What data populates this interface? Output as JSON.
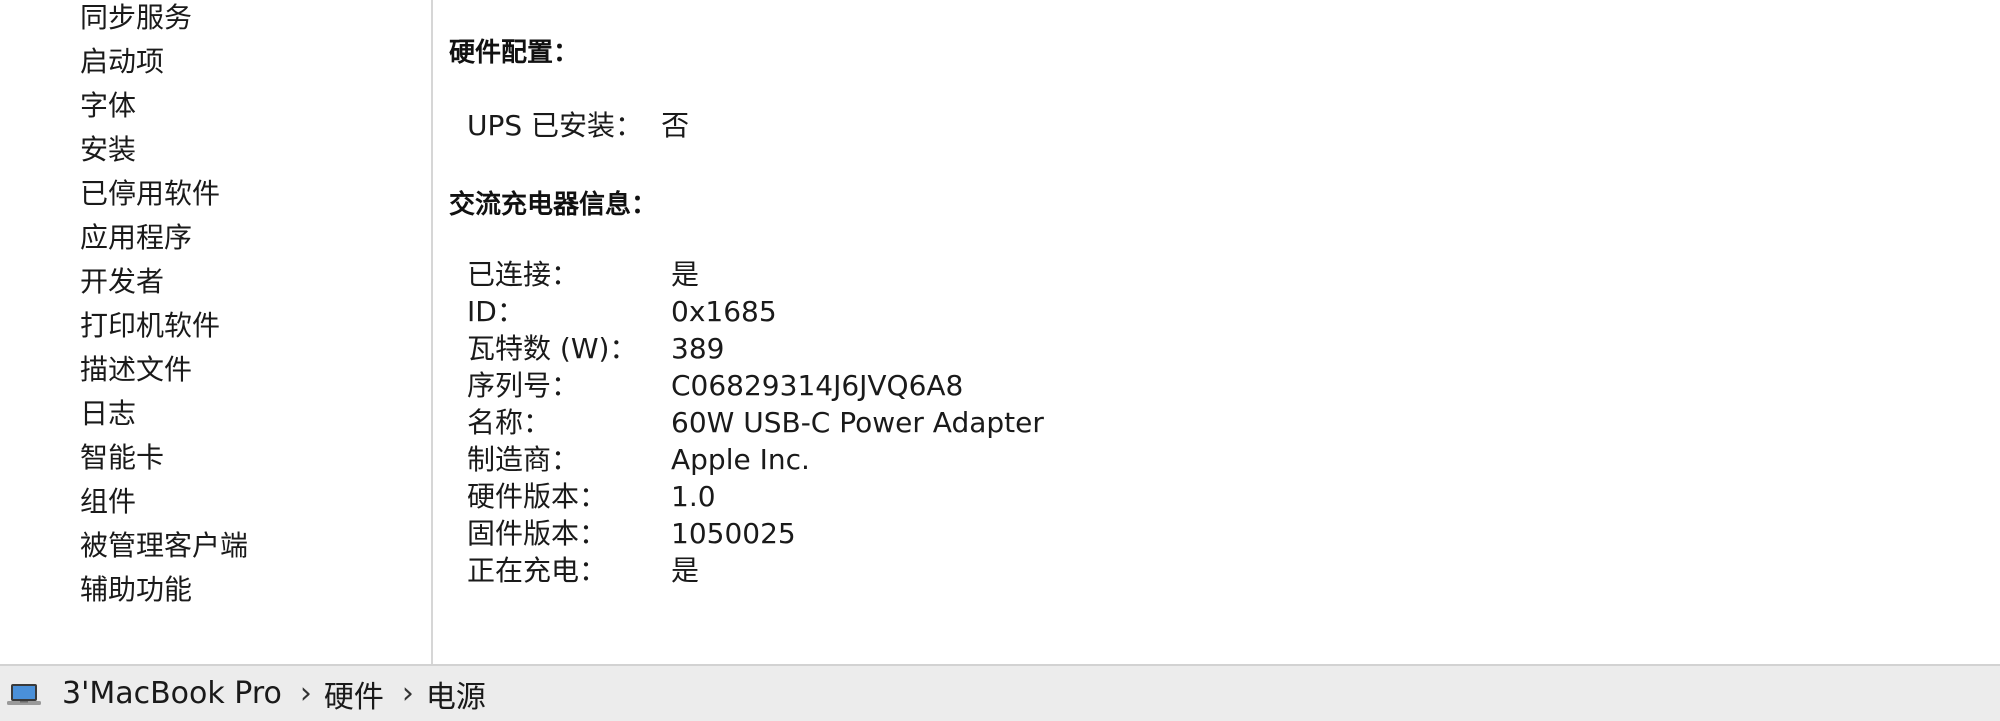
{
  "sidebar": {
    "items": [
      "同步服务",
      "启动项",
      "字体",
      "安装",
      "已停用软件",
      "应用程序",
      "开发者",
      "打印机软件",
      "描述文件",
      "日志",
      "智能卡",
      "组件",
      "被管理客户端",
      "辅助功能"
    ]
  },
  "main": {
    "hardware_config": {
      "title": "硬件配置：",
      "ups_label": "UPS 已安装：",
      "ups_value": "否"
    },
    "ac_charger": {
      "title": "交流充电器信息：",
      "rows": [
        {
          "key": "已连接：",
          "value": "是"
        },
        {
          "key": "ID：",
          "value": "0x1685"
        },
        {
          "key": "瓦特数 (W)：",
          "value": "389"
        },
        {
          "key": "序列号：",
          "value": "C06829314J6JVQ6A8"
        },
        {
          "key": "名称：",
          "value": "60W USB-C Power Adapter"
        },
        {
          "key": "制造商：",
          "value": "Apple Inc."
        },
        {
          "key": "硬件版本：",
          "value": "1.0"
        },
        {
          "key": "固件版本：",
          "value": "1050025"
        },
        {
          "key": "正在充电：",
          "value": "是"
        }
      ]
    }
  },
  "pathbar": {
    "icon": "laptop-icon",
    "segments": [
      "3'MacBook Pro",
      "硬件",
      "电源"
    ],
    "separator": "›"
  }
}
